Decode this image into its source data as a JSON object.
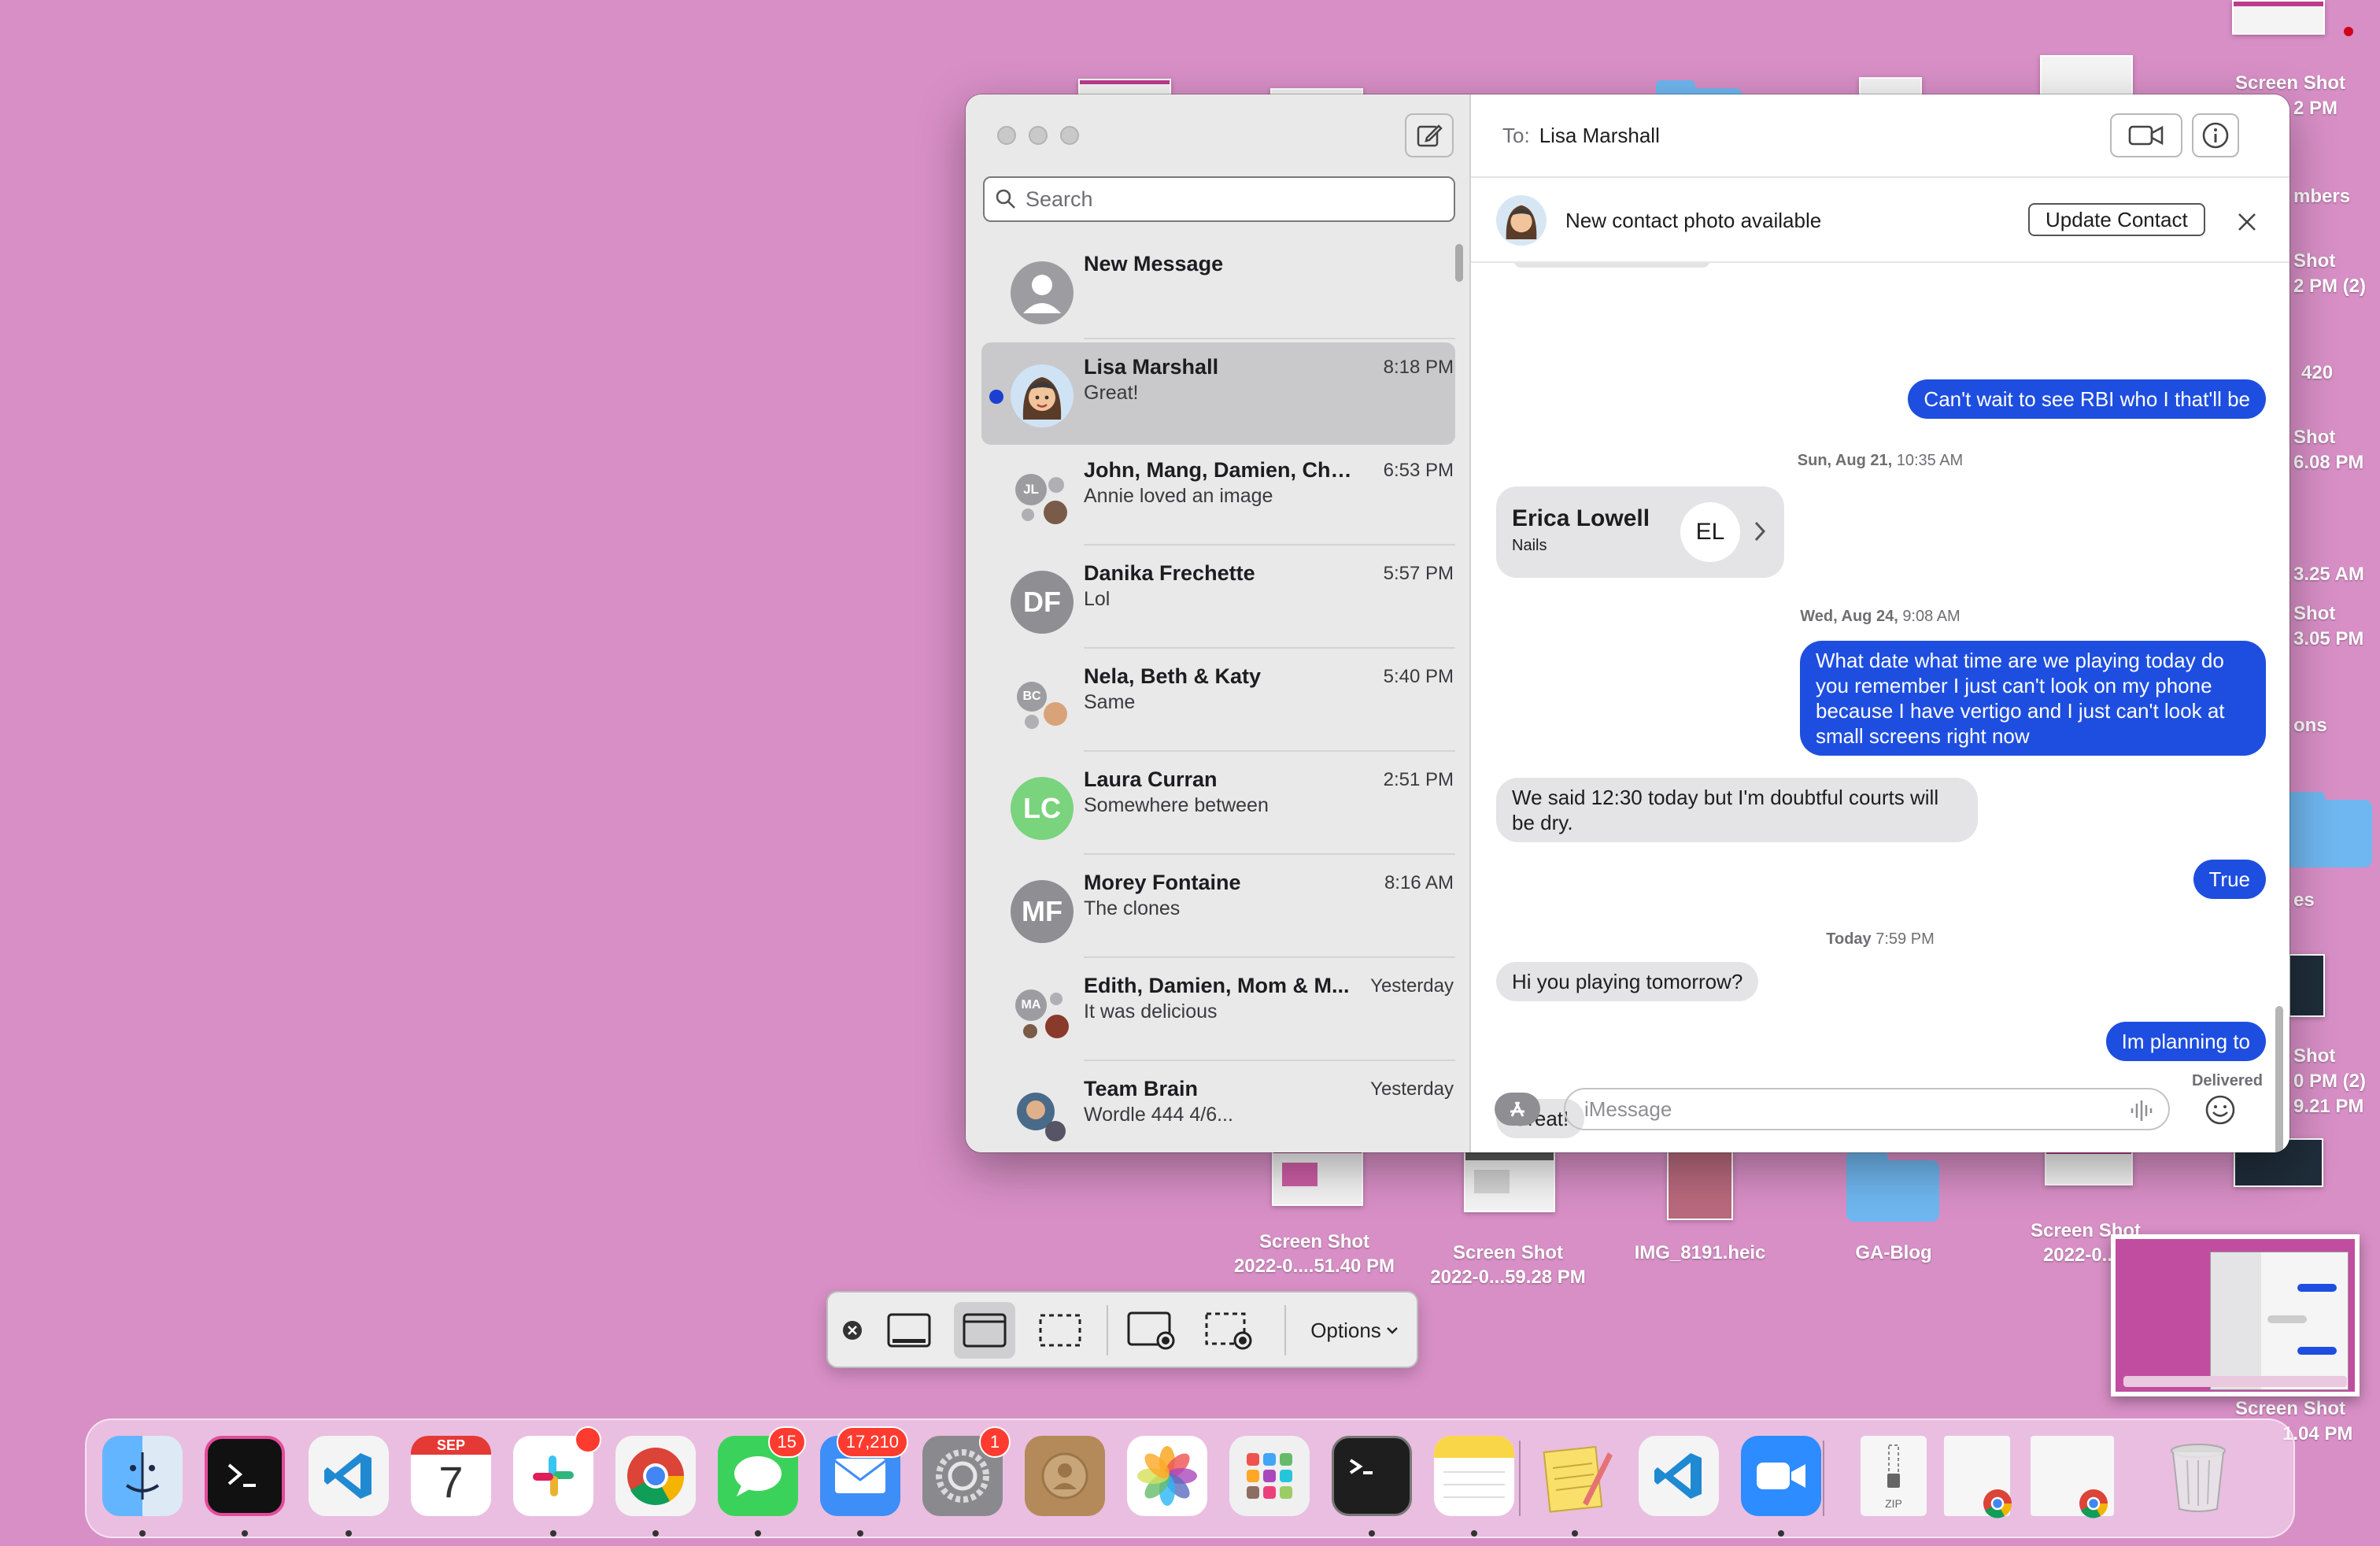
{
  "desktop": {
    "files": [
      {
        "line1": "Screen Shot",
        "line2": "2022-0....51.40 PM"
      },
      {
        "line1": "Screen Shot",
        "line2": "2022-0...59.28 PM"
      },
      {
        "line1": "IMG_8191.heic",
        "line2": ""
      },
      {
        "line1": "GA-Blog",
        "line2": ""
      },
      {
        "line1": "Screen Shot",
        "line2": "2022-0...2"
      }
    ],
    "right_labels": [
      "Screen Shot",
      "2 PM",
      "mbers",
      "Shot",
      "2 PM (2)",
      "420",
      "Shot",
      "6.08 PM",
      "3.25 AM",
      "Shot",
      "3.05 PM",
      "ons",
      "es",
      "Shot",
      "0 PM (2)",
      "9.21 PM",
      "Screen Shot",
      "1.04 PM"
    ]
  },
  "sidebar": {
    "search_placeholder": "Search",
    "conversations": [
      {
        "name": "New Message",
        "time": "",
        "preview": "",
        "initials": ""
      },
      {
        "name": "Lisa Marshall",
        "time": "8:18 PM",
        "preview": "Great!",
        "initials": ""
      },
      {
        "name": "John, Mang, Damien, Chri...",
        "time": "6:53 PM",
        "preview": "Annie loved an image",
        "initials": "JL"
      },
      {
        "name": "Danika Frechette",
        "time": "5:57 PM",
        "preview": "Lol",
        "initials": "DF"
      },
      {
        "name": "Nela, Beth & Katy",
        "time": "5:40 PM",
        "preview": "Same",
        "initials": "BC"
      },
      {
        "name": "Laura Curran",
        "time": "2:51 PM",
        "preview": "Somewhere between",
        "initials": "LC"
      },
      {
        "name": "Morey Fontaine",
        "time": "8:16 AM",
        "preview": "The clones",
        "initials": "MF"
      },
      {
        "name": "Edith, Damien, Mom & M...",
        "time": "Yesterday",
        "preview": "It was delicious",
        "initials": "MA"
      },
      {
        "name": "Team Brain",
        "time": "Yesterday",
        "preview": "Wordle 444 4/6...",
        "initials": ""
      }
    ]
  },
  "chat": {
    "to_label": "To:",
    "recipient": "Lisa Marshall",
    "banner_text": "New contact photo available",
    "update_button": "Update Contact",
    "messages": {
      "m1": "Can't wait to see RBI who I that'll be",
      "ts1_day": "Sun, Aug 21,",
      "ts1_time": "10:35 AM",
      "card_name": "Erica Lowell",
      "card_sub": "Nails",
      "card_initials": "EL",
      "ts2_day": "Wed, Aug 24,",
      "ts2_time": "9:08 AM",
      "m2": "What date what time are we playing today do you remember I just can't look on my phone because I have vertigo and I just can't look at small screens right now",
      "m3": "We said 12:30 today but I'm doubtful courts will be dry.",
      "m4": "True",
      "ts3_day": "Today",
      "ts3_time": "7:59 PM",
      "m5": "Hi you playing tomorrow?",
      "m6": "Im planning to",
      "delivered": "Delivered",
      "m7": "Great!"
    },
    "input_placeholder": "iMessage"
  },
  "screenshot_toolbar": {
    "options_label": "Options"
  },
  "dock": {
    "calendar_month": "SEP",
    "calendar_day": "7",
    "badge_messages": "15",
    "badge_mail": "17,210",
    "badge_settings": "1",
    "zip_label": "ZIP"
  },
  "colors": {
    "desktop": "#d88fc6",
    "imessage_blue": "#1e4ee0",
    "unread_dot": "#1a3fd1"
  }
}
